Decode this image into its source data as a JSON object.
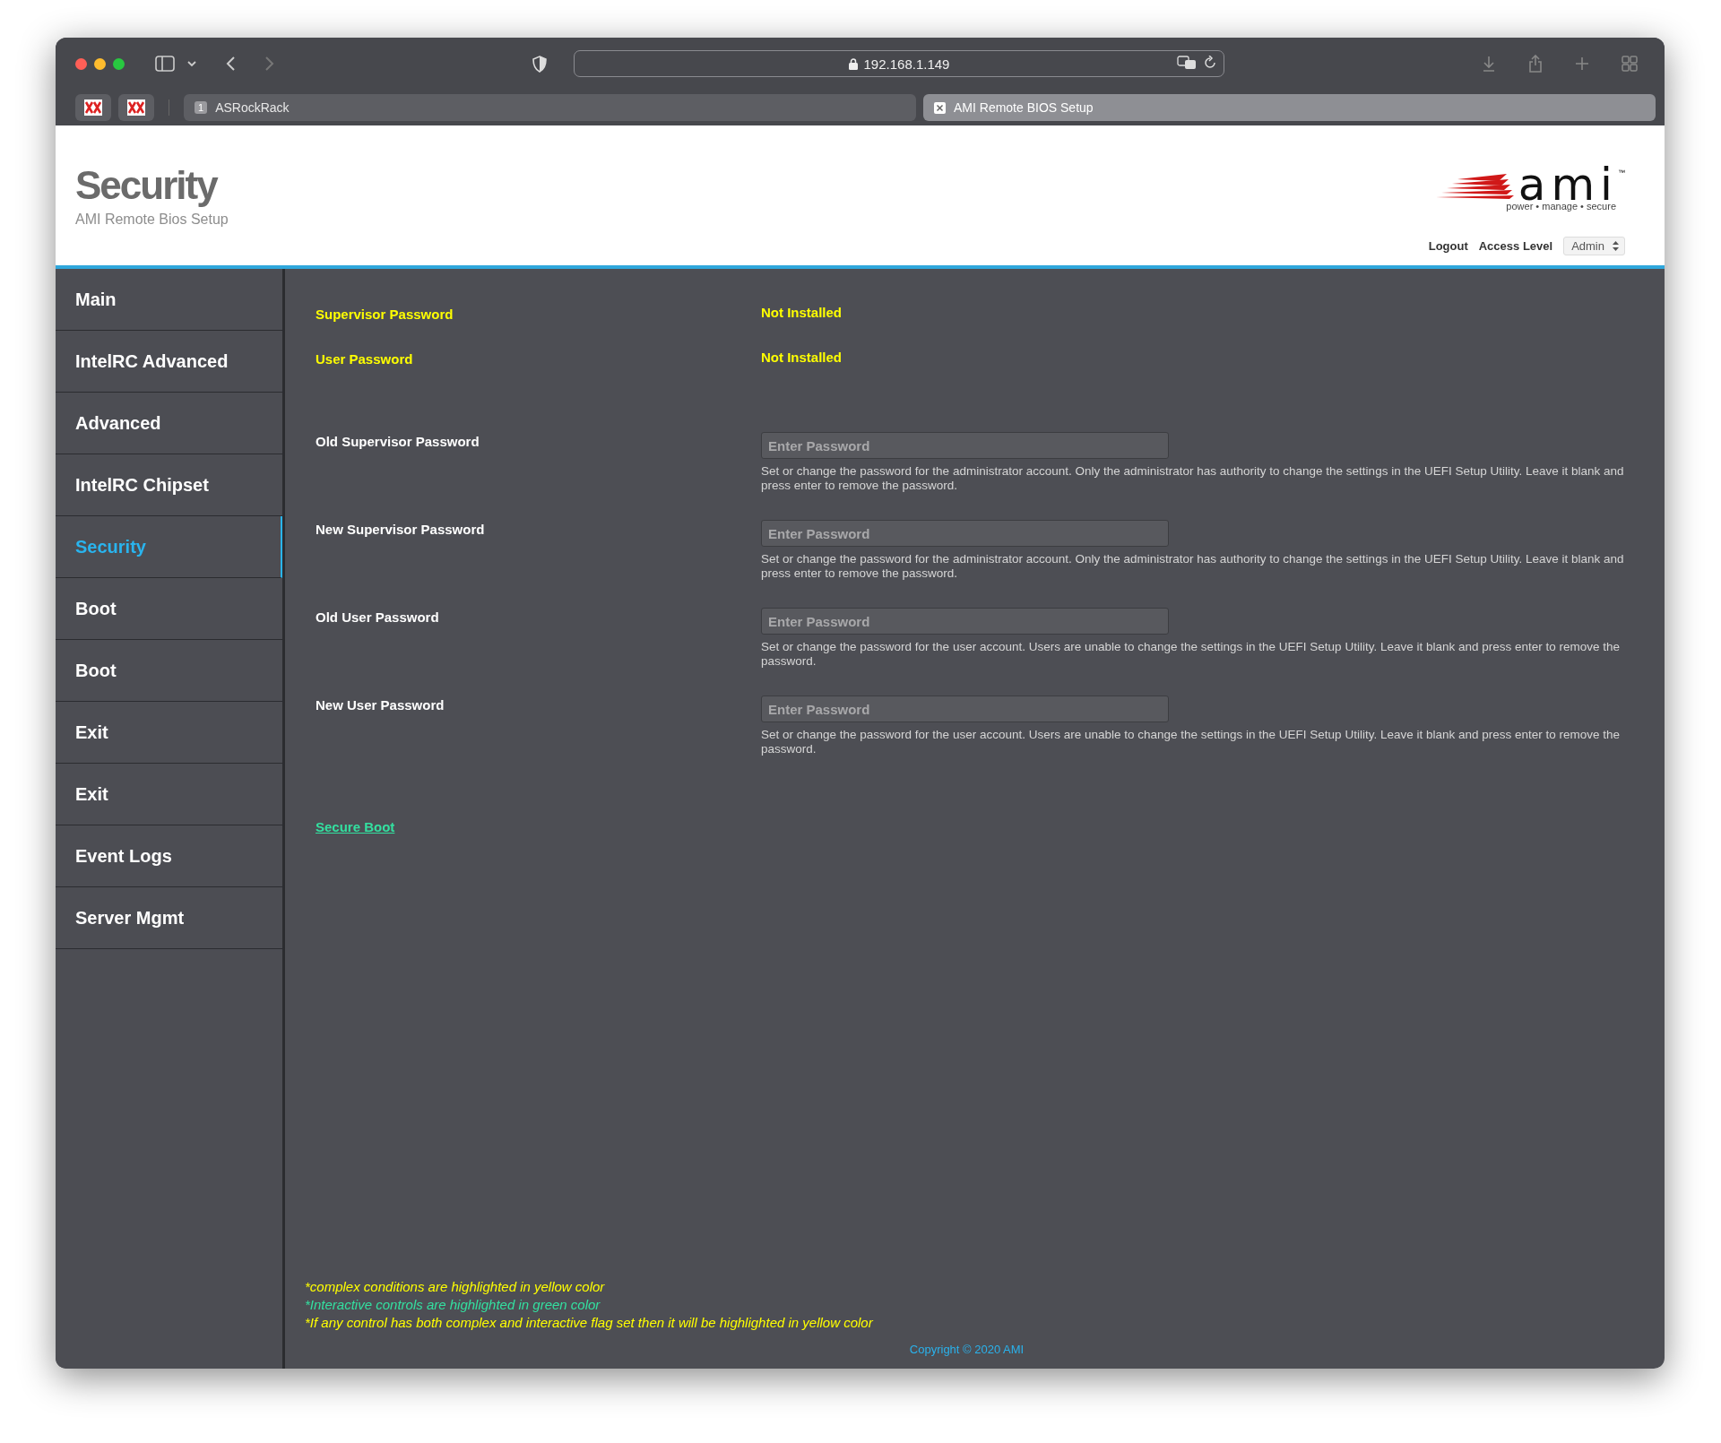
{
  "browser": {
    "url": "192.168.1.149",
    "pinned_tabs": [
      {
        "selected": false
      },
      {
        "selected": false
      }
    ],
    "tabs": [
      {
        "label": "ASRockRack",
        "badge": "1",
        "selected": false
      },
      {
        "label": "AMI Remote BIOS Setup",
        "selected": true
      }
    ]
  },
  "header": {
    "title": "Security",
    "subtitle": "AMI Remote Bios Setup",
    "logo": {
      "wordmark": "ami",
      "trademark": "™",
      "tagline": "power • manage • secure"
    },
    "logout": "Logout",
    "access_level_label": "Access Level",
    "access_level": "Admin"
  },
  "sidebar": {
    "items": [
      {
        "label": "Main",
        "selected": false
      },
      {
        "label": "IntelRC Advanced",
        "selected": false
      },
      {
        "label": "Advanced",
        "selected": false
      },
      {
        "label": "IntelRC Chipset",
        "selected": false
      },
      {
        "label": "Security",
        "selected": true
      },
      {
        "label": "Boot",
        "selected": false
      },
      {
        "label": "Boot",
        "selected": false
      },
      {
        "label": "Exit",
        "selected": false
      },
      {
        "label": "Exit",
        "selected": false
      },
      {
        "label": "Event Logs",
        "selected": false
      },
      {
        "label": "Server Mgmt",
        "selected": false
      }
    ]
  },
  "settings": [
    {
      "kind": "status",
      "label": "Supervisor Password",
      "value": "Not Installed"
    },
    {
      "kind": "status",
      "label": "User Password",
      "value": "Not Installed"
    },
    {
      "kind": "password",
      "label": "Old Supervisor Password",
      "placeholder": "Enter Password",
      "help": "Set or change the password for the administrator account. Only the administrator has authority to change the settings in the UEFI Setup Utility. Leave it blank and press enter to remove the password."
    },
    {
      "kind": "password",
      "label": "New Supervisor Password",
      "placeholder": "Enter Password",
      "help": "Set or change the password for the administrator account. Only the administrator has authority to change the settings in the UEFI Setup Utility. Leave it blank and press enter to remove the password."
    },
    {
      "kind": "password",
      "label": "Old User Password",
      "placeholder": "Enter Password",
      "help": "Set or change the password for the user account. Users are unable to change the settings in the UEFI Setup Utility. Leave it blank and press enter to remove the password."
    },
    {
      "kind": "password",
      "label": "New User Password",
      "placeholder": "Enter Password",
      "help": "Set or change the password for the user account. Users are unable to change the settings in the UEFI Setup Utility. Leave it blank and press enter to remove the password."
    },
    {
      "kind": "link",
      "label": "Secure Boot"
    }
  ],
  "legend": [
    {
      "text": "*complex conditions are highlighted in yellow color",
      "color": "#ffff00"
    },
    {
      "text": "*Interactive controls are highlighted in green color",
      "color": "#33e0a0"
    },
    {
      "text": "*If any control has both complex and interactive flag set then it will be highlighted in yellow color",
      "color": "#ffff00"
    }
  ],
  "copyright": "Copyright © 2020 AMI"
}
